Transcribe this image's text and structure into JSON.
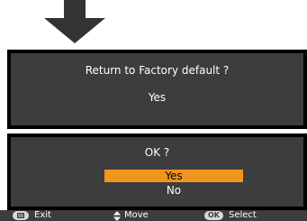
{
  "dialog_top": {
    "title": "Return to Factory default ?",
    "option": "Yes"
  },
  "dialog_bottom": {
    "title": "OK ?",
    "options": [
      "Yes",
      "No"
    ],
    "selected": "Yes"
  },
  "footer": {
    "exit": "Exit",
    "move": "Move",
    "ok_key": "OK",
    "select": "Select"
  },
  "colors": {
    "highlight": "#f0951f",
    "panel": "#3d3d3d"
  }
}
